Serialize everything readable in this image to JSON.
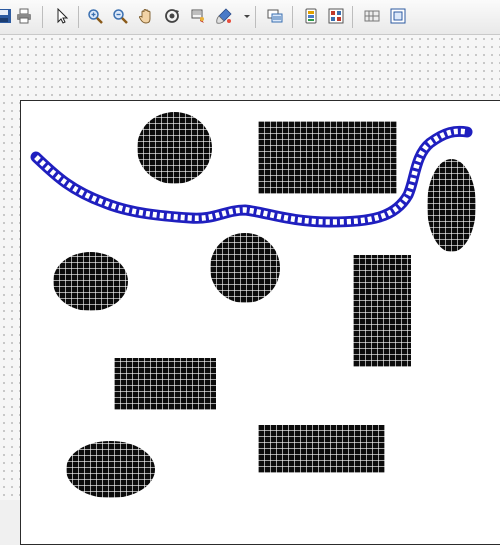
{
  "toolbar": {
    "buttons": [
      {
        "name": "save-icon",
        "color": "#2c5aa0"
      },
      {
        "name": "print-icon",
        "color": "#555555"
      },
      {
        "name": "select-arrow-icon",
        "color": "#222222"
      },
      {
        "name": "zoom-in-icon",
        "color": "#3a6fb0"
      },
      {
        "name": "zoom-out-icon",
        "color": "#3a6fb0"
      },
      {
        "name": "pan-hand-icon",
        "color": "#7a5a2a"
      },
      {
        "name": "rotate-icon",
        "color": "#444444"
      },
      {
        "name": "flag-icon",
        "color": "#c0392b"
      },
      {
        "name": "brush-icon",
        "color": "#4a7ac8"
      },
      {
        "name": "layers-icon",
        "color": "#3a6fb0"
      },
      {
        "name": "palette-icon",
        "color": "#e0a000"
      },
      {
        "name": "grid-view-icon",
        "color": "#c0392b"
      },
      {
        "name": "split-view-icon",
        "color": "#555555"
      },
      {
        "name": "page-frame-icon",
        "color": "#2c5aa0"
      }
    ]
  },
  "canvas": {
    "path_color": "#1f1fbf",
    "shape_color": "#0c0c0c",
    "shapes": [
      {
        "name": "ellipse-top-center"
      },
      {
        "name": "rect-top-right"
      },
      {
        "name": "ellipse-right"
      },
      {
        "name": "ellipse-left"
      },
      {
        "name": "ellipse-center"
      },
      {
        "name": "rect-right-tall"
      },
      {
        "name": "rect-center-bottom"
      },
      {
        "name": "rect-bottom-right"
      },
      {
        "name": "ellipse-bottom-left"
      }
    ]
  }
}
